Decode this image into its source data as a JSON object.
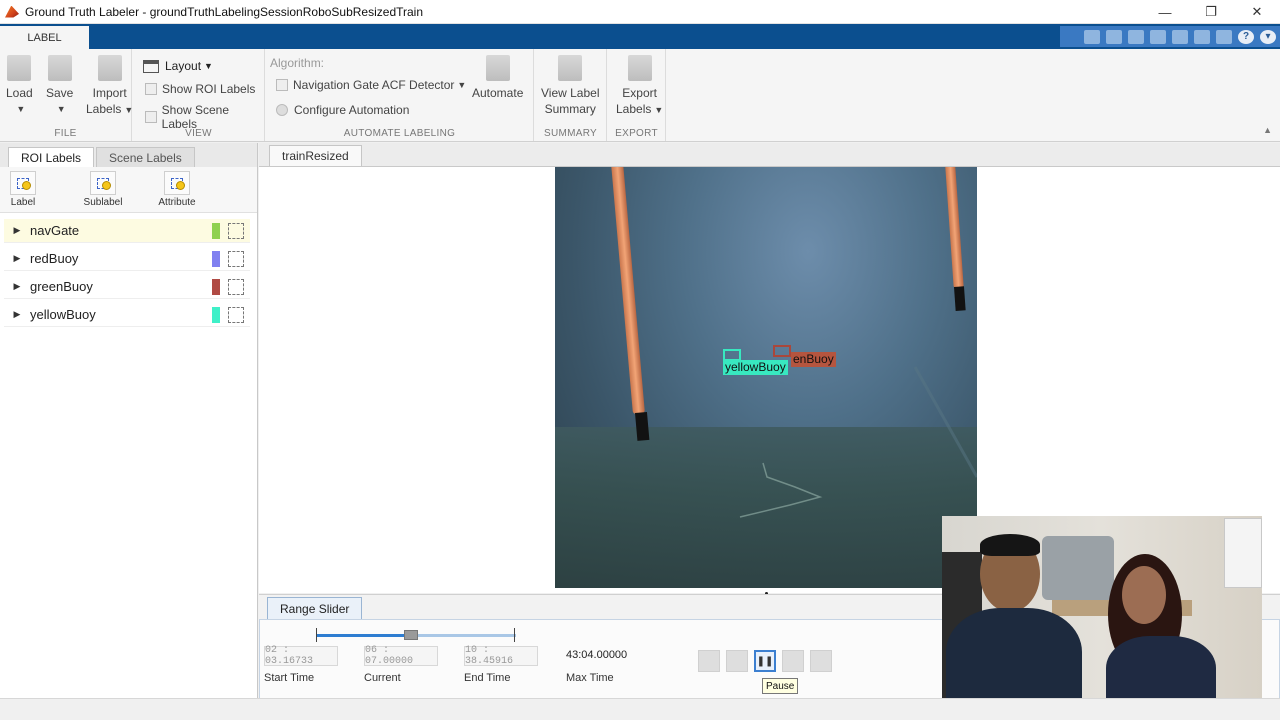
{
  "window": {
    "title": "Ground Truth Labeler - groundTruthLabelingSessionRoboSubResizedTrain",
    "controls": [
      "—",
      "❐",
      "✕"
    ]
  },
  "tabstrip": {
    "active_tab": "LABEL"
  },
  "ribbon": {
    "file": {
      "section_title": "FILE",
      "load": "Load",
      "save": "Save",
      "import_line1": "Import",
      "import_line2": "Labels"
    },
    "view": {
      "section_title": "VIEW",
      "layout": "Layout",
      "show_roi_labels": "Show ROI Labels",
      "show_scene_labels": "Show Scene Labels"
    },
    "automate": {
      "section_title": "AUTOMATE LABELING",
      "algorithm_label": "Algorithm:",
      "algorithm_value": "Navigation Gate ACF Detector",
      "configure": "Configure Automation",
      "automate": "Automate"
    },
    "summary": {
      "section_title": "SUMMARY",
      "line1": "View Label",
      "line2": "Summary"
    },
    "export": {
      "section_title": "EXPORT",
      "line1": "Export",
      "line2": "Labels"
    }
  },
  "left_panel": {
    "tabs": [
      "ROI Labels",
      "Scene Labels"
    ],
    "tools": [
      "Label",
      "Sublabel",
      "Attribute"
    ],
    "labels": [
      {
        "name": "navGate",
        "color": "#8fd14f"
      },
      {
        "name": "redBuoy",
        "color": "#8080f0"
      },
      {
        "name": "greenBuoy",
        "color": "#b04a44"
      },
      {
        "name": "yellowBuoy",
        "color": "#3ff0c8"
      }
    ]
  },
  "document": {
    "tab": "trainResized",
    "annotations": [
      {
        "text": "enBuoy",
        "color": "#b5553f"
      },
      {
        "text": "yellowBuoy",
        "color": "#38e8c0"
      }
    ]
  },
  "range_slider": {
    "tab": "Range Slider",
    "start_time": "02 : 03.16733",
    "current": "06 : 07.00000",
    "end_time": "10 : 38.45916",
    "max_time": "43:04.00000",
    "labels": {
      "start": "Start Time",
      "current": "Current",
      "end": "End Time",
      "max": "Max Time"
    },
    "tooltip": "Pause"
  },
  "accent": "#0b4f8f"
}
